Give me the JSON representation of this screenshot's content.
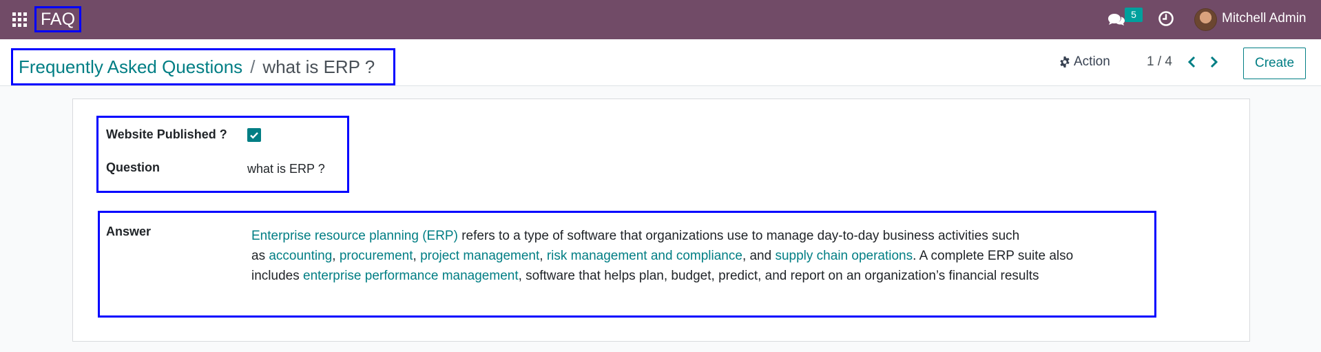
{
  "navbar": {
    "app_name": "FAQ",
    "messages_count": "5",
    "user_name": "Mitchell Admin"
  },
  "breadcrumb": {
    "parent": "Frequently Asked Questions",
    "separator": "/",
    "current": "what is ERP ?"
  },
  "toolbar": {
    "action_label": "Action",
    "pager": "1 / 4",
    "create_label": "Create"
  },
  "form": {
    "website_published_label": "Website Published ?",
    "website_published": true,
    "question_label": "Question",
    "question_value": "what is ERP ?",
    "answer_label": "Answer",
    "answer": {
      "line1_link": "Enterprise resource planning (ERP)",
      "line1_text": " refers to a type of software that organizations use to manage day-to-day business activities such",
      "line2_pre": "as ",
      "link_accounting": "accounting",
      "sep1": ", ",
      "link_procurement": "procurement",
      "sep2": ", ",
      "link_project": "project management",
      "sep3": ", ",
      "link_risk": "risk management and compliance",
      "sep4": ", and ",
      "link_supply": "supply chain operations",
      "line2_post": ". A complete ERP suite also",
      "line3_pre": "includes ",
      "link_epm": "enterprise performance management",
      "line3_post": ", software that helps plan, budget, predict, and report on an organization’s financial results"
    }
  },
  "colors": {
    "navbar": "#714b67",
    "accent": "#017e84",
    "badge": "#00a09d",
    "annotation": "#0000ff"
  }
}
